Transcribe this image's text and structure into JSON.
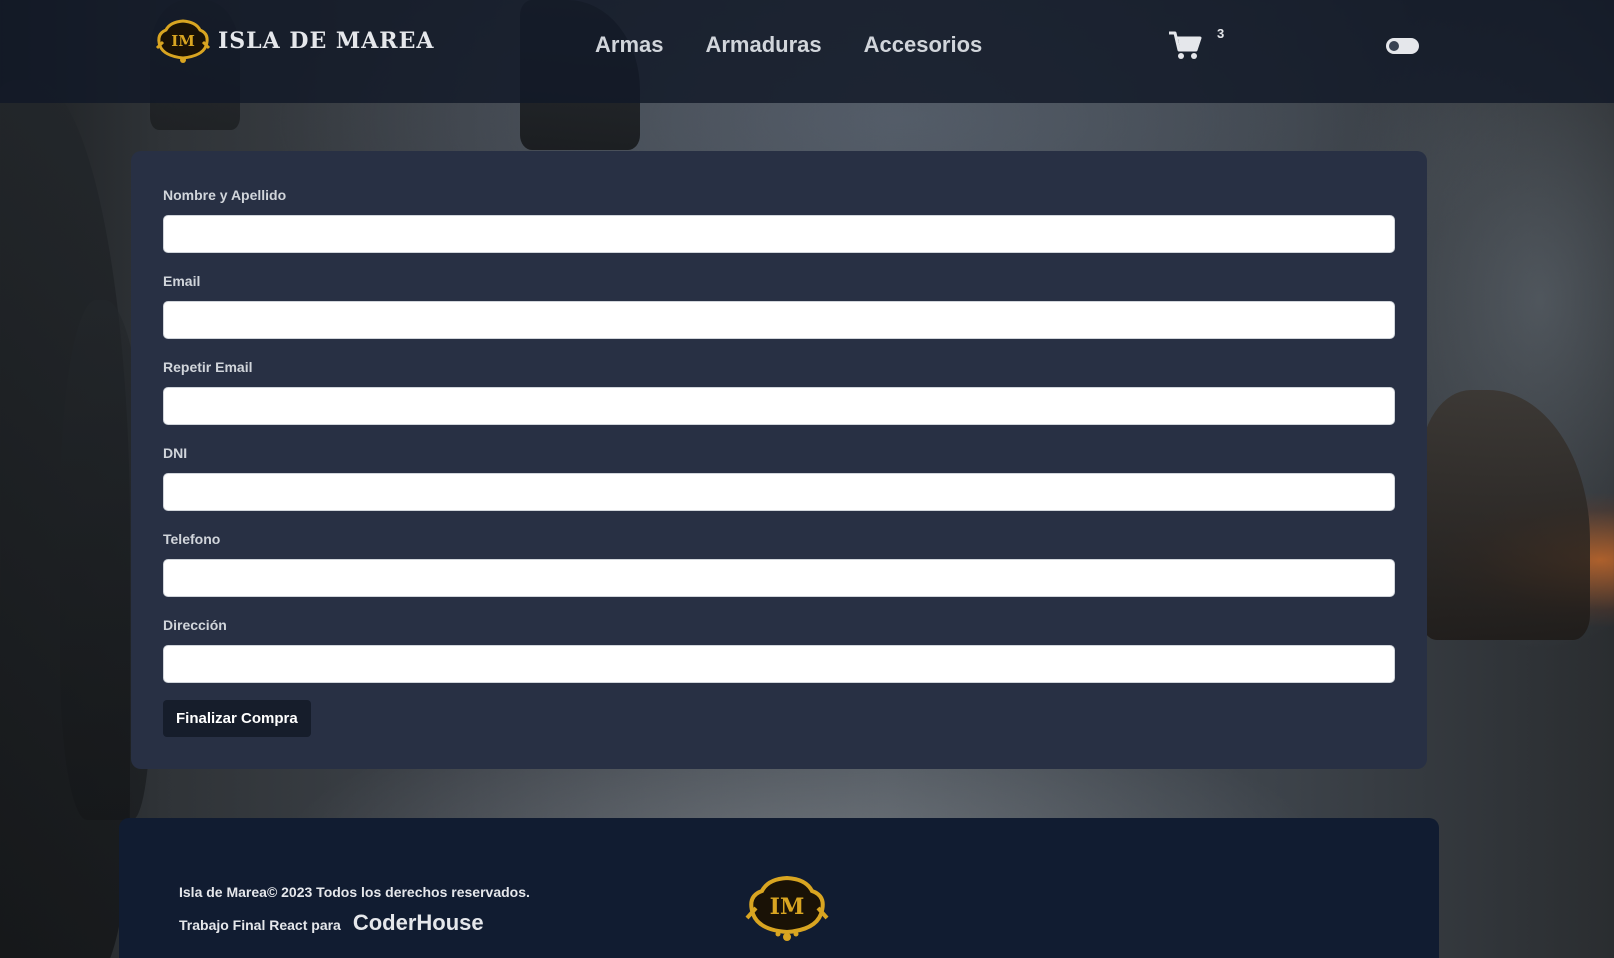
{
  "header": {
    "brand_name": "ISLA DE MAREA",
    "logo_monogram": "IM",
    "nav": [
      {
        "label": "Armas"
      },
      {
        "label": "Armaduras"
      },
      {
        "label": "Accesorios"
      }
    ],
    "cart_icon": "shopping-cart-icon",
    "cart_count": "3",
    "theme_toggle_state": "off"
  },
  "form": {
    "fields": [
      {
        "label": "Nombre y Apellido",
        "value": "",
        "placeholder": ""
      },
      {
        "label": "Email",
        "value": "",
        "placeholder": ""
      },
      {
        "label": "Repetir Email",
        "value": "",
        "placeholder": ""
      },
      {
        "label": "DNI",
        "value": "",
        "placeholder": ""
      },
      {
        "label": "Telefono",
        "value": "",
        "placeholder": ""
      },
      {
        "label": "Dirección",
        "value": "",
        "placeholder": ""
      }
    ],
    "submit_label": "Finalizar Compra"
  },
  "footer": {
    "copyright": "Isla de Marea© 2023 Todos los derechos reservados.",
    "credit_prefix": "Trabajo Final React para",
    "credit_link": "CoderHouse",
    "logo_monogram": "IM"
  },
  "colors": {
    "header_bg": "#111827",
    "card_bg": "#283044",
    "footer_bg": "#111c31",
    "button_bg": "#161d2b",
    "logo_gold": "#d9a521"
  }
}
